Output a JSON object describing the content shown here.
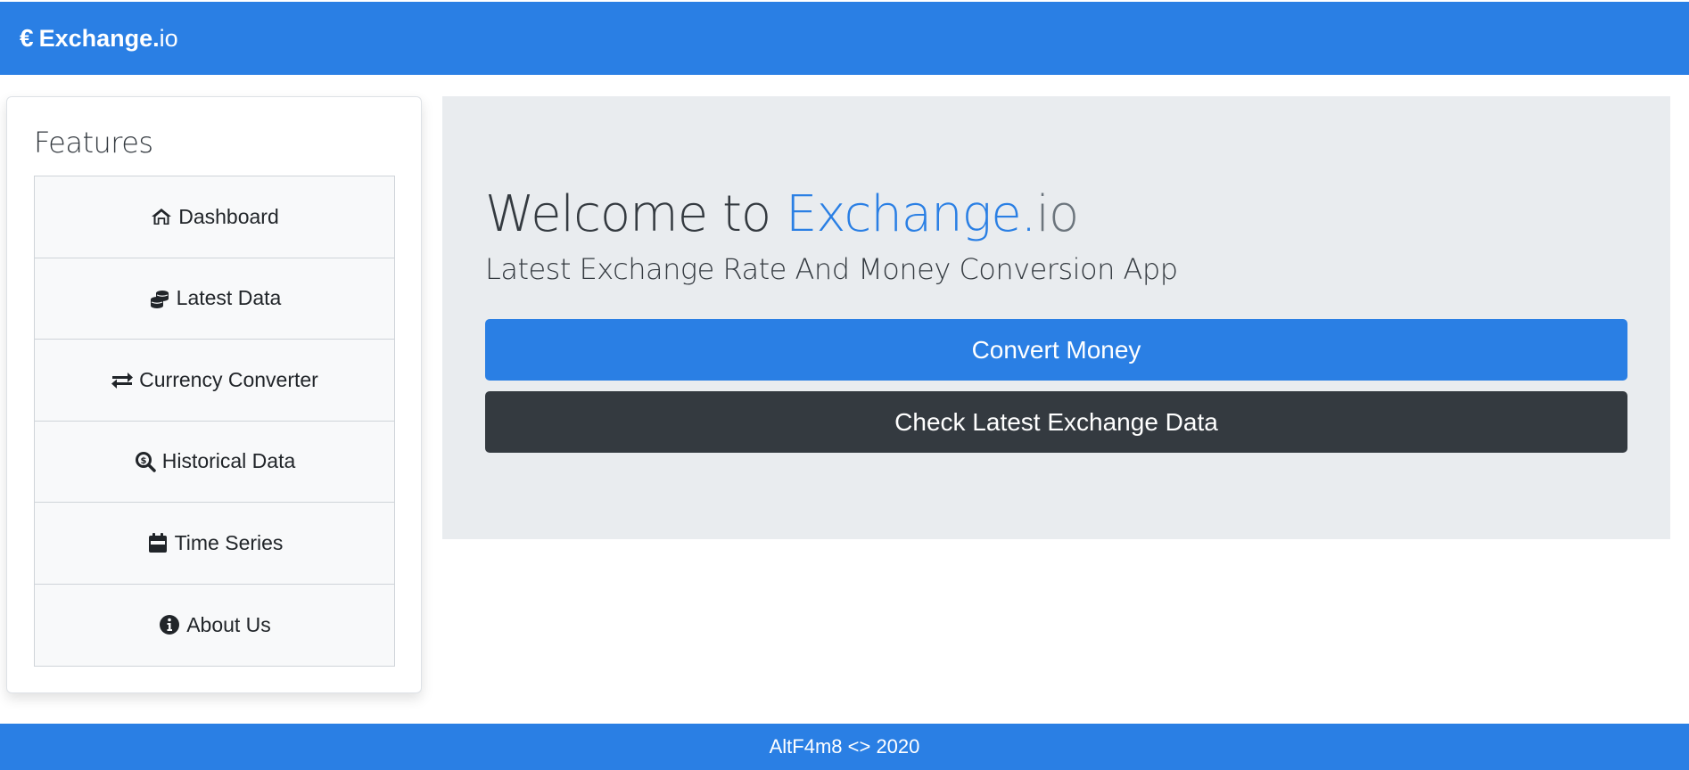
{
  "colors": {
    "brand_blue": "#2a7fe4",
    "dark": "#343a40",
    "jumbotron_bg": "#e9ecef"
  },
  "navbar": {
    "brand_icon": "euro-icon",
    "brand_symbol": "€",
    "brand_bold": "Exchange.",
    "brand_light": "io"
  },
  "sidebar": {
    "title": "Features",
    "items": [
      {
        "label": "Dashboard",
        "icon": "home-icon"
      },
      {
        "label": "Latest Data",
        "icon": "coins-icon"
      },
      {
        "label": "Currency Converter",
        "icon": "exchange-arrows-icon"
      },
      {
        "label": "Historical Data",
        "icon": "search-dollar-icon"
      },
      {
        "label": "Time Series",
        "icon": "calendar-icon"
      },
      {
        "label": "About Us",
        "icon": "info-circle-icon"
      }
    ]
  },
  "hero": {
    "welcome_prefix": "Welcome to ",
    "welcome_brand": "Exchange.",
    "welcome_suffix": "io",
    "subtitle": "Latest Exchange Rate And Money Conversion App",
    "primary_button": "Convert Money",
    "secondary_button": "Check Latest Exchange Data"
  },
  "footer": {
    "text": "AltF4m8 <> 2020"
  }
}
